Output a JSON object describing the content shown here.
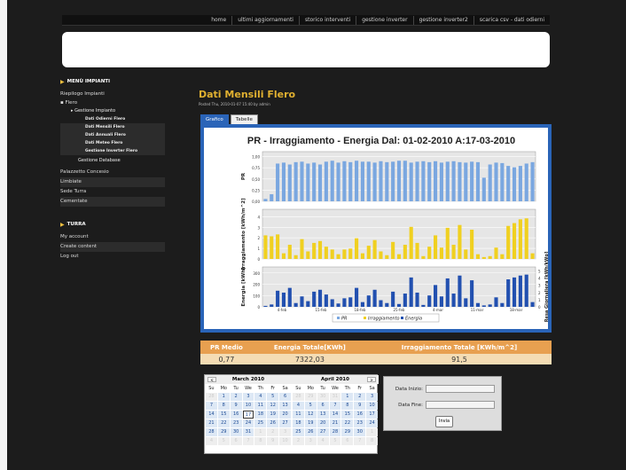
{
  "nav": {
    "items": [
      "home",
      "ultimi aggiornamenti",
      "storico interventi",
      "gestione inverter",
      "gestione inverter2",
      "scarica csv - dati odierni"
    ]
  },
  "sidebar": {
    "menu_title": "MENÙ IMPIANTI",
    "riepilogo": "Riepilogo Impianti",
    "flero": "Flero",
    "gestione_impianto": "Gestione Impianto",
    "subs": [
      "Dati Odierni Flero",
      "Dati Mensili Flero",
      "Dati Annuali Flero",
      "Dati Meteo Flero",
      "Gestione Inverter Flero"
    ],
    "gestione_database": "Gestione Database",
    "others": [
      "Palazzetto Concesio",
      "Limbiate",
      "Sede Turra",
      "Cementate"
    ],
    "turra_title": "TURRA",
    "account": [
      "My account",
      "Create content",
      "Log out"
    ]
  },
  "page": {
    "title": "Dati Mensili Flero",
    "posted": "Posted Thu, 2010-01-07 15:40 by admin"
  },
  "tabs": [
    "Grafico",
    "Tabelle"
  ],
  "chart_data": {
    "type": "bar",
    "title": "PR - Irraggiamento - Energia Dal: 01-02-2010 A:17-03-2010",
    "x": [
      "4-feb",
      "15-feb",
      "18-feb",
      "25-feb",
      "4-mar",
      "11-mar",
      "18-mar"
    ],
    "legend": [
      "PR",
      "Irraggiamento",
      "Energia"
    ],
    "colors": {
      "PR": "#7aa7e0",
      "Irraggiamento": "#f0d020",
      "Energia": "#2250b0"
    },
    "panels": [
      {
        "ylabel": "PR",
        "ylim": [
          0,
          1
        ],
        "yticks": [
          "1,00",
          "0,75",
          "0,50",
          "0,25",
          "0,00"
        ]
      },
      {
        "ylabel": "Irraggiamento [kWh/m^2]",
        "ylim": [
          0,
          5
        ],
        "yticks": [
          "4",
          "3",
          "2",
          "1",
          "0"
        ]
      },
      {
        "ylabel": "Energia [kWh]",
        "ylabel_right": "Resa Giornaliera [kWh/kWp]",
        "ylim": [
          0,
          400
        ],
        "yticks": [
          "300",
          "200",
          "100",
          "0"
        ],
        "yticks_right": [
          "5",
          "4",
          "3",
          "2",
          "1",
          "0"
        ]
      }
    ],
    "series": [
      {
        "name": "PR",
        "values": [
          0.05,
          0.15,
          0.8,
          0.82,
          0.78,
          0.83,
          0.84,
          0.8,
          0.82,
          0.78,
          0.84,
          0.86,
          0.82,
          0.85,
          0.83,
          0.86,
          0.84,
          0.84,
          0.82,
          0.85,
          0.83,
          0.84,
          0.86,
          0.86,
          0.82,
          0.84,
          0.85,
          0.83,
          0.85,
          0.82,
          0.84,
          0.85,
          0.83,
          0.82,
          0.84,
          0.83,
          0.5,
          0.78,
          0.82,
          0.81,
          0.75,
          0.72,
          0.75,
          0.8,
          0.83
        ]
      },
      {
        "name": "Irraggiamento",
        "values": [
          2.5,
          2.4,
          2.6,
          0.6,
          1.5,
          0.4,
          2.1,
          0.8,
          1.7,
          1.9,
          1.3,
          1.0,
          0.5,
          1.0,
          1.1,
          2.2,
          0.6,
          1.4,
          2.0,
          0.8,
          0.4,
          1.8,
          0.5,
          1.5,
          3.4,
          1.7,
          0.3,
          1.3,
          2.5,
          1.2,
          3.3,
          1.5,
          3.6,
          1.0,
          3.1,
          0.5,
          0.2,
          0.3,
          1.2,
          0.5,
          3.5,
          3.8,
          4.2,
          4.3,
          0.6
        ]
      },
      {
        "name": "Energia",
        "values": [
          10,
          25,
          170,
          150,
          200,
          40,
          110,
          60,
          160,
          180,
          130,
          80,
          35,
          90,
          100,
          200,
          50,
          120,
          180,
          70,
          40,
          160,
          30,
          140,
          310,
          150,
          20,
          120,
          230,
          110,
          300,
          140,
          330,
          90,
          280,
          40,
          15,
          25,
          100,
          40,
          290,
          310,
          330,
          340,
          50
        ]
      }
    ]
  },
  "stats": {
    "headers": [
      "PR Medio",
      "Energia Totale[KWh]",
      "Irraggiamento Totale [KWh/m^2]"
    ],
    "values": [
      "0,77",
      "7322,03",
      "91,5"
    ]
  },
  "calendar": {
    "months": [
      {
        "title": "March 2010",
        "prev": "<",
        "days": [
          "28",
          "1",
          "2",
          "3",
          "4",
          "5",
          "6",
          "7",
          "8",
          "9",
          "10",
          "11",
          "12",
          "13",
          "14",
          "15",
          "16",
          "17",
          "18",
          "19",
          "20",
          "21",
          "22",
          "23",
          "24",
          "25",
          "26",
          "27",
          "28",
          "29",
          "30",
          "31",
          "1",
          "2",
          "3",
          "4",
          "5",
          "6",
          "7",
          "8",
          "9",
          "10"
        ],
        "off": [
          0,
          32,
          33,
          34,
          35,
          36,
          37,
          38,
          39,
          40,
          41
        ],
        "today": 17
      },
      {
        "title": "April 2010",
        "next": ">",
        "days": [
          "28",
          "29",
          "30",
          "31",
          "1",
          "2",
          "3",
          "4",
          "5",
          "6",
          "7",
          "8",
          "9",
          "10",
          "11",
          "12",
          "13",
          "14",
          "15",
          "16",
          "17",
          "18",
          "19",
          "20",
          "21",
          "22",
          "23",
          "24",
          "25",
          "26",
          "27",
          "28",
          "29",
          "30",
          "1",
          "2",
          "3",
          "4",
          "5",
          "6",
          "7",
          "8"
        ],
        "off": [
          0,
          1,
          2,
          3,
          34,
          35,
          36,
          37,
          38,
          39,
          40,
          41
        ],
        "today": -1
      }
    ],
    "dow": [
      "Su",
      "Mo",
      "Tu",
      "We",
      "Th",
      "Fr",
      "Sa"
    ]
  },
  "form": {
    "start_label": "Data Inizio:",
    "end_label": "Data Fine:",
    "submit": "Invia"
  }
}
